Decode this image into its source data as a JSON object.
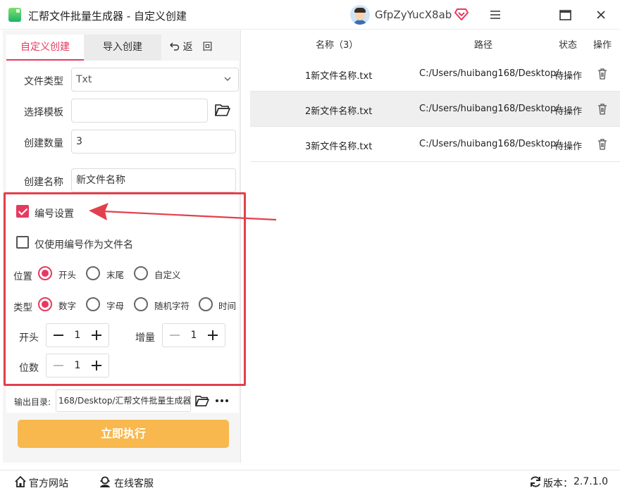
{
  "window": {
    "title": "汇帮文件批量生成器 - 自定义创建",
    "username": "GfpZyYucX8ab"
  },
  "tabs": {
    "custom": "自定义创建",
    "import": "导入创建",
    "back": "返　回"
  },
  "form": {
    "file_type_label": "文件类型",
    "file_type_value": "Txt",
    "template_label": "选择模板",
    "template_value": "",
    "count_label": "创建数量",
    "count_value": "3",
    "name_label": "创建名称",
    "name_value": "新文件名称"
  },
  "numbering": {
    "enable_label": "编号设置",
    "enable_checked": true,
    "only_number_label": "仅使用编号作为文件名",
    "only_number_checked": false,
    "position_label": "位置",
    "position_options": [
      "开头",
      "末尾",
      "自定义"
    ],
    "position_selected": "开头",
    "type_label": "类型",
    "type_options": [
      "数字",
      "字母",
      "随机字符",
      "时间"
    ],
    "type_selected": "数字",
    "start_label": "开头",
    "start_value": "1",
    "increment_label": "增量",
    "increment_value": "1",
    "digits_label": "位数",
    "digits_value": "1"
  },
  "output": {
    "label": "输出目录:",
    "path": "168/Desktop/汇帮文件批量生成器"
  },
  "run_label": "立即执行",
  "table": {
    "headers": {
      "name": "名称（3）",
      "path": "路径",
      "status": "状态",
      "action": "操作"
    },
    "rows": [
      {
        "name": "1新文件名称.txt",
        "path": "C:/Users/huibang168/Desktop/",
        "status": "待操作"
      },
      {
        "name": "2新文件名称.txt",
        "path": "C:/Users/huibang168/Desktop/",
        "status": "待操作"
      },
      {
        "name": "3新文件名称.txt",
        "path": "C:/Users/huibang168/Desktop/",
        "status": "待操作"
      }
    ]
  },
  "footer": {
    "website": "官方网站",
    "support": "在线客服",
    "version_label": "版本：",
    "version": "2.7.1.0"
  },
  "colors": {
    "accent": "#e53a60",
    "run_button": "#f8b84d",
    "highlight_border": "#e2404c"
  }
}
